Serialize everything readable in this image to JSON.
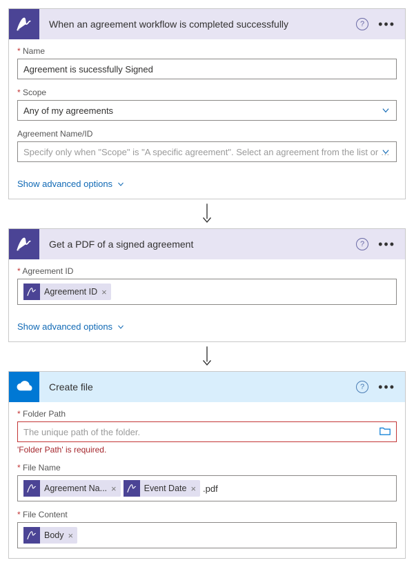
{
  "card1": {
    "title": "When an agreement workflow is completed successfully",
    "name_label": "Name",
    "name_value": "Agreement is sucessfully Signed",
    "scope_label": "Scope",
    "scope_value": "Any of my agreements",
    "agreement_label": "Agreement Name/ID",
    "agreement_placeholder": "Specify only when \"Scope\" is \"A specific agreement\". Select an agreement from the list or enter th",
    "advanced": "Show advanced options"
  },
  "card2": {
    "title": "Get a PDF of a signed agreement",
    "agreement_id_label": "Agreement ID",
    "token_agreement_id": "Agreement ID",
    "advanced": "Show advanced options"
  },
  "card3": {
    "title": "Create file",
    "folder_label": "Folder Path",
    "folder_placeholder": "The unique path of the folder.",
    "folder_error": "'Folder Path' is required.",
    "filename_label": "File Name",
    "token_agreement_name": "Agreement Na...",
    "token_event_date": "Event Date",
    "filename_suffix": ".pdf",
    "filecontent_label": "File Content",
    "token_body": "Body"
  }
}
